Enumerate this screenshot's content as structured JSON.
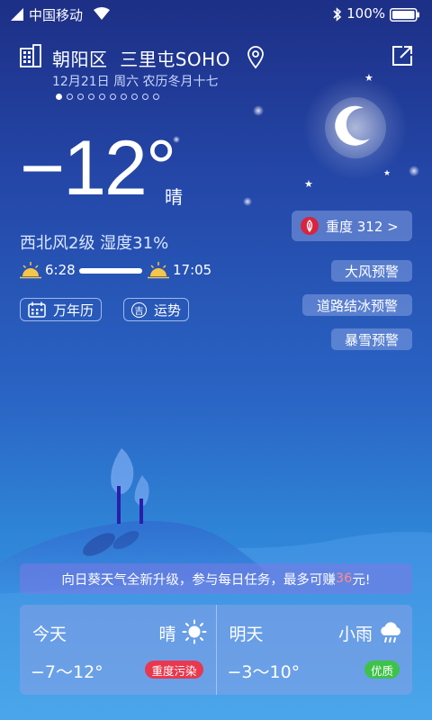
{
  "status_bar": {
    "carrier": "中国移动",
    "battery": "100%"
  },
  "header": {
    "location": "朝阳区  三里屯SOHO",
    "date": "12月21日 周六 农历冬月十七",
    "page_count": 10,
    "active_page": 0
  },
  "current": {
    "temperature": "−12°",
    "condition": "晴",
    "wind_humidity": "西北风2级 湿度31%",
    "sunrise": "6:28",
    "sunset": "17:05",
    "sun_progress": 1.0
  },
  "links": {
    "calendar": "万年历",
    "fortune": "运势",
    "fortune_badge": "吉"
  },
  "aqi": {
    "label": "重度 312 >",
    "color": "#d8243f"
  },
  "alerts": [
    "大风预警",
    "道路结冰预警",
    "暴雪预警"
  ],
  "banner": {
    "prefix": "向日葵天气全新升级，参与每日任务，最多可赚",
    "amount": "36",
    "suffix": "元!"
  },
  "forecast": {
    "today": {
      "day": "今天",
      "condition": "晴",
      "range": "−7～12°",
      "quality": "重度污染",
      "quality_color": "#e8384f",
      "icon": "sun-icon"
    },
    "tomorrow": {
      "day": "明天",
      "condition": "小雨",
      "range": "−3～10°",
      "quality": "优质",
      "quality_color": "#3fc24a",
      "icon": "rain-cloud-icon"
    }
  }
}
